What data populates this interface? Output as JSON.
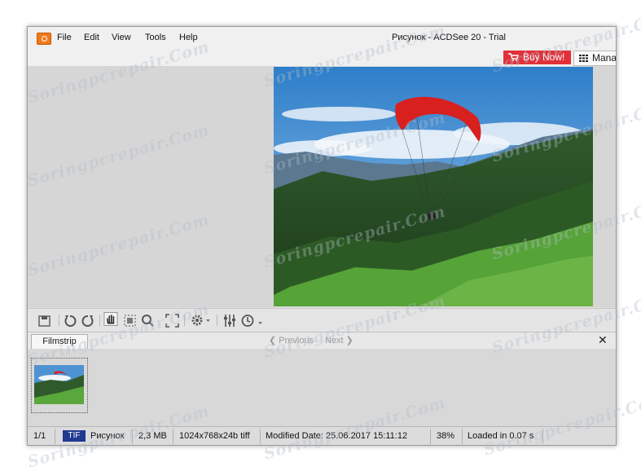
{
  "window": {
    "title": "Рисунок - ACDSee 20 - Trial",
    "menu": [
      "File",
      "Edit",
      "View",
      "Tools",
      "Help"
    ]
  },
  "ribbon": {
    "buy_label": "Buy Now!",
    "manage_label": "Mana"
  },
  "toolbar": {
    "icons": [
      "save-icon",
      "rotate-left-icon",
      "rotate-right-icon",
      "hand-tool-icon",
      "select-tool-icon",
      "zoom-icon",
      "fit-icon",
      "settings-icon",
      "adjust-icon",
      "history-icon"
    ]
  },
  "filmstrip": {
    "tab_label": "Filmstrip",
    "previous_label": "Previous",
    "next_label": "Next",
    "close_label": "✕"
  },
  "status": {
    "index": "1/1",
    "format": "TIF",
    "name": "Рисунок",
    "size": "2,3 MB",
    "dimensions": "1024x768x24b tiff",
    "modified": "Modified Date: 25.06.2017 15:11:12",
    "zoom": "38%",
    "loaded": "Loaded in 0.07 s"
  },
  "watermark": "Soringpcrepair.Com",
  "colors": {
    "buy_button": "#e2303a",
    "format_badge": "#1f3a8f",
    "app_icon": "#f07a1a"
  }
}
